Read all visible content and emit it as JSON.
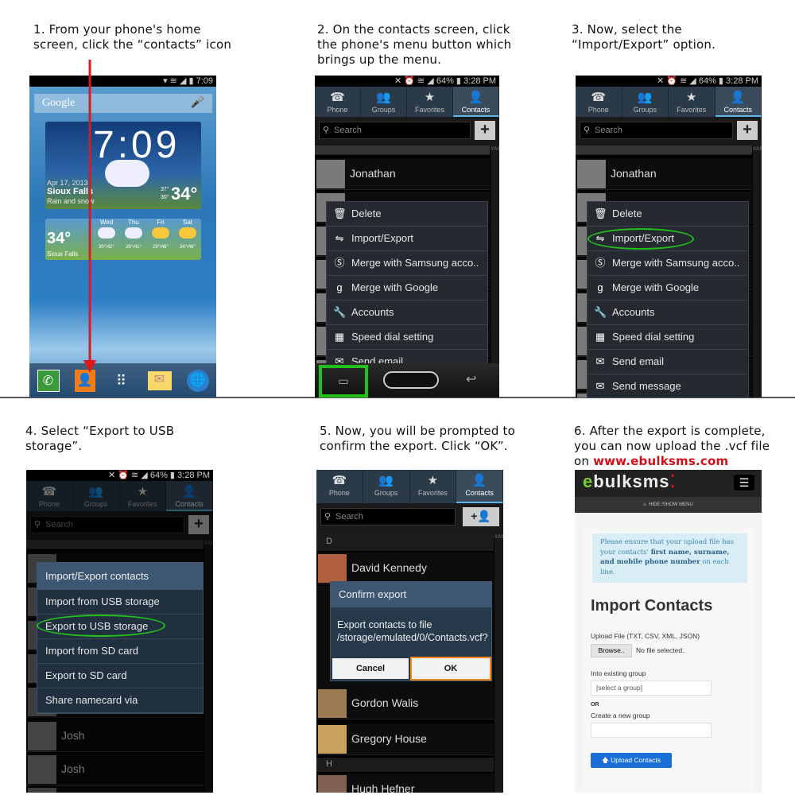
{
  "steps": [
    {
      "caption": "1. From your phone's home\nscreen, click the “contacts” icon"
    },
    {
      "caption": "2. On the contacts screen, click\nthe phone's menu button which\nbrings up the menu."
    },
    {
      "caption": "3. Now, select the\n“Import/Export” option."
    },
    {
      "caption": "4. Select “Export to USB\nstorage”."
    },
    {
      "caption": "5. Now, you will be prompted to\nconfirm the export. Click “OK”."
    },
    {
      "caption": "6. After the export is complete,\nyou can now upload the .vcf file\non ",
      "link": "www.ebulksms.com"
    }
  ],
  "colors": {
    "highlight_green": "#22c01a",
    "highlight_orange": "#f08a1c",
    "arrow_red": "#e01818",
    "link_red": "#d0101a",
    "site_blue": "#1a6fd6"
  },
  "home": {
    "status_time": "7:09",
    "search_label": "Google",
    "clock": "7:09",
    "date": "Apr 17, 2013",
    "city": "Sioux Falls",
    "condition": "Rain and snow",
    "temp": "34°",
    "hi": "37°",
    "lo": "30°",
    "forecast_current": "34°",
    "forecast_city": "Sioux Falls",
    "forecast": [
      {
        "day": "Wed",
        "range": "30°/42°"
      },
      {
        "day": "Thu",
        "range": "29°/41°"
      },
      {
        "day": "Fri",
        "range": "29°/48°"
      },
      {
        "day": "Sat",
        "range": "34°/46°"
      }
    ],
    "dock_icons": [
      "phone-icon",
      "contacts-icon",
      "apps-icon",
      "email-icon",
      "internet-icon"
    ]
  },
  "contacts": {
    "status_time": "3:28 PM",
    "battery": "64%",
    "tabs": [
      "Phone",
      "Groups",
      "Favorites",
      "Contacts"
    ],
    "search_placeholder": "Search",
    "contact_top": "Jonathan",
    "index_letters": "#ABCDEFGHIJKLMNOPQRSTUVWXYZ"
  },
  "menu": [
    {
      "label": "Delete",
      "icon": "trash-icon"
    },
    {
      "label": "Import/Export",
      "icon": "import-export-icon"
    },
    {
      "label": "Merge with Samsung acco..",
      "icon": "samsung-icon"
    },
    {
      "label": "Merge with Google",
      "icon": "google-icon"
    },
    {
      "label": "Accounts",
      "icon": "key-icon"
    },
    {
      "label": "Speed dial setting",
      "icon": "speed-dial-icon"
    },
    {
      "label": "Send email",
      "icon": "email-icon"
    },
    {
      "label": "Send message",
      "icon": "message-icon"
    }
  ],
  "import_dialog": {
    "title": "Import/Export contacts",
    "items": [
      "Import from USB storage",
      "Export to USB storage",
      "Import from SD card",
      "Export to SD card",
      "Share namecard via"
    ],
    "below": [
      "Josh",
      "Josh"
    ]
  },
  "confirm": {
    "section_d": "D",
    "section_h": "H",
    "contacts_above": [
      "David Kennedy"
    ],
    "contacts_below": [
      "Gordon Walis",
      "Gregory House",
      "Hugh Hefner"
    ],
    "title": "Confirm export",
    "message": "Export contacts to file /storage/emulated/0/Contacts.vcf?",
    "cancel": "Cancel",
    "ok": "OK"
  },
  "site": {
    "logo_e": "e",
    "logo_rest": "bulksms",
    "menu_toggle": "HIDE /SHOW MENU",
    "notice_pre": "Please ensure that your upload file has your contacts' ",
    "notice_bold": "first name, surname, and mobile phone number",
    "notice_post": " on each line.",
    "heading": "Import Contacts",
    "upload_label": "Upload File (TXT, CSV, XML, JSON)",
    "browse": "Browse..",
    "no_file": "No file selected.",
    "group_label": "Into existing group",
    "group_select": "[select a group]",
    "or": "OR",
    "new_group_label": "Create a new group",
    "new_group_value": "",
    "upload_button": "Upload Contacts"
  }
}
